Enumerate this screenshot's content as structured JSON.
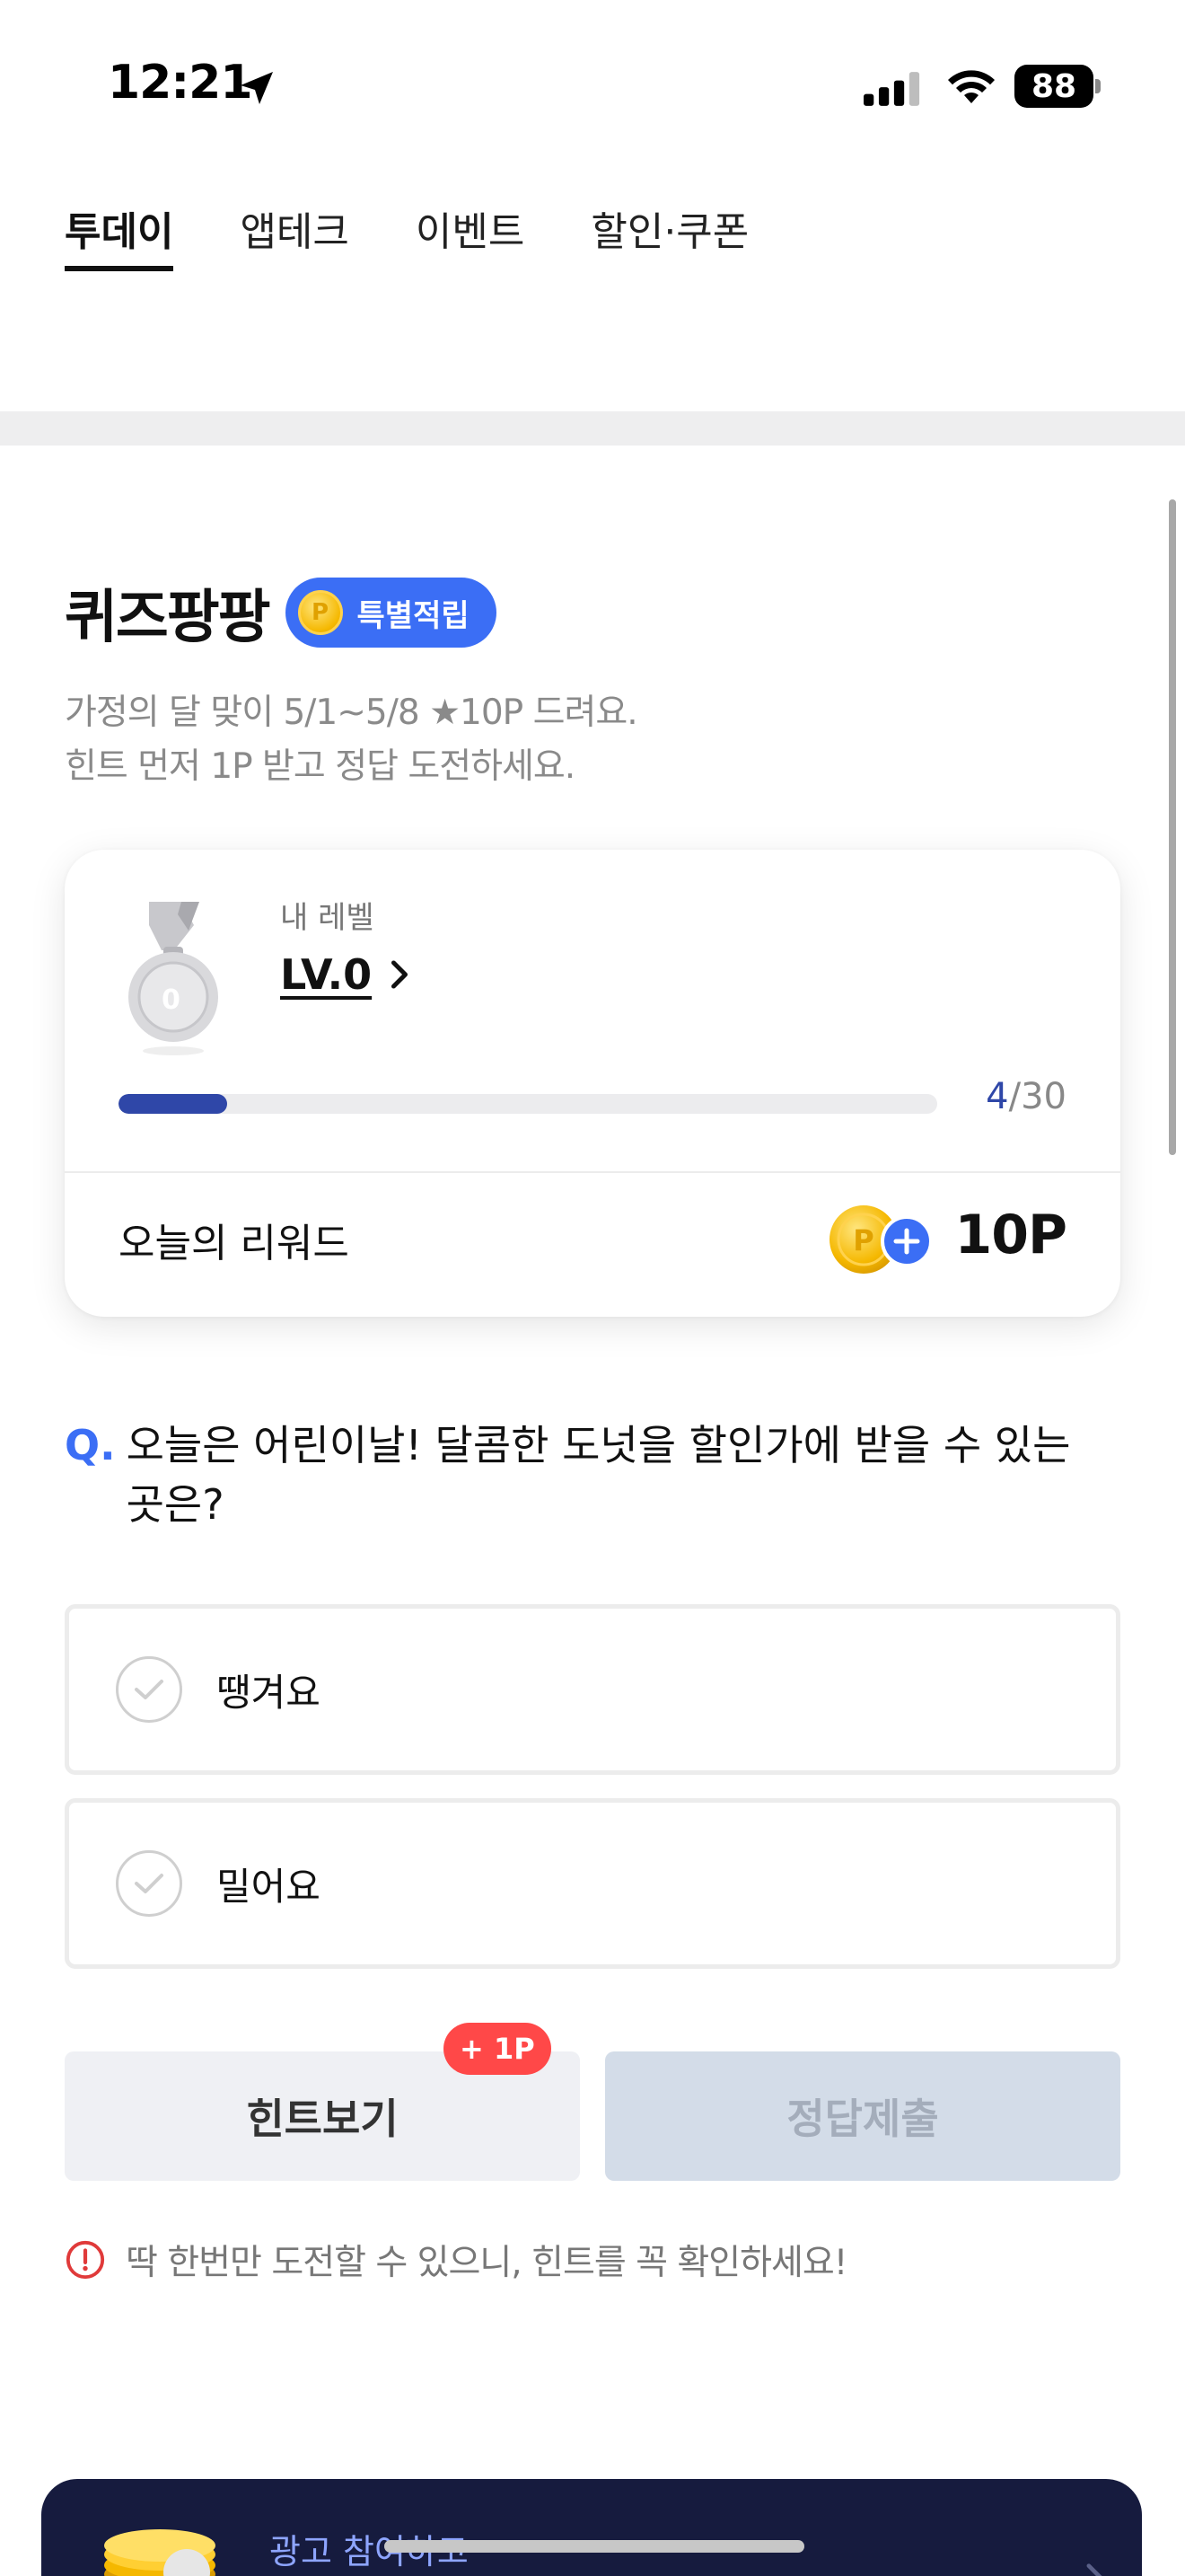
{
  "status_bar": {
    "time": "12:21",
    "battery": "88",
    "icons": [
      "location-arrow-icon",
      "cellular-signal-icon",
      "wifi-icon",
      "battery-icon"
    ]
  },
  "tabs": [
    {
      "label": "투데이",
      "active": true
    },
    {
      "label": "앱테크",
      "active": false
    },
    {
      "label": "이벤트",
      "active": false
    },
    {
      "label": "할인·쿠폰",
      "active": false
    }
  ],
  "quiz": {
    "title": "퀴즈팡팡",
    "badge_label": "특별적립",
    "badge_coin": "P",
    "desc_line1": "가정의 달 맞이 5/1~5/8 ★10P 드려요.",
    "desc_line2": "힌트 먼저 1P 받고 정답 도전하세요."
  },
  "level": {
    "label": "내 레벨",
    "value": "LV.0",
    "medal_number": "0",
    "progress_current": "4",
    "progress_total": "/30",
    "progress_fraction": 0.133
  },
  "reward": {
    "label": "오늘의 리워드",
    "value": "10P",
    "coin": "P"
  },
  "question": {
    "mark": "Q.",
    "text": "오늘은 어린이날! 달콤한 도넛을 할인가에 받을 수 있는 곳은?"
  },
  "options": [
    {
      "label": "땡겨요"
    },
    {
      "label": "밀어요"
    }
  ],
  "buttons": {
    "hint_label": "힌트보기",
    "hint_badge": "+ 1P",
    "submit_label": "정답제출"
  },
  "warning": "딱 한번만 도전할 수 있으니, 힌트를 꼭 확인하세요!",
  "ad": {
    "text": "광고 참여하고"
  },
  "colors": {
    "accent": "#3b6ef5",
    "progress": "#2f47a8",
    "hint_badge": "#ff4848",
    "warning_icon": "#e03a3a",
    "ad_background": "#161b3e"
  }
}
